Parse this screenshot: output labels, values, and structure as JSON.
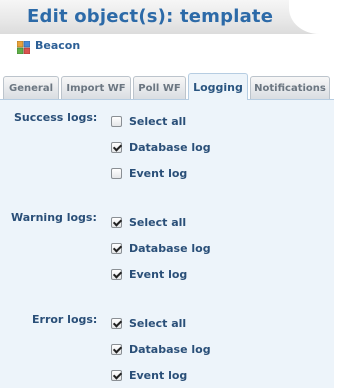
{
  "dialog": {
    "title": "Edit object(s): template"
  },
  "object": {
    "name": "Beacon",
    "icon": "colored-squares-icon"
  },
  "tabs": [
    {
      "label": "General",
      "active": false
    },
    {
      "label": "Import WF",
      "active": false
    },
    {
      "label": "Poll WF",
      "active": false
    },
    {
      "label": "Logging",
      "active": true
    },
    {
      "label": "Notifications",
      "active": false
    }
  ],
  "logging": {
    "success": {
      "label": "Success logs:",
      "options": [
        {
          "label": "Select all",
          "checked": false
        },
        {
          "label": "Database log",
          "checked": true
        },
        {
          "label": "Event log",
          "checked": false
        }
      ]
    },
    "warning": {
      "label": "Warning logs:",
      "options": [
        {
          "label": "Select all",
          "checked": true
        },
        {
          "label": "Database log",
          "checked": true
        },
        {
          "label": "Event log",
          "checked": true
        }
      ]
    },
    "error": {
      "label": "Error logs:",
      "options": [
        {
          "label": "Select all",
          "checked": true
        },
        {
          "label": "Database log",
          "checked": true
        },
        {
          "label": "Event log",
          "checked": true
        }
      ]
    }
  }
}
